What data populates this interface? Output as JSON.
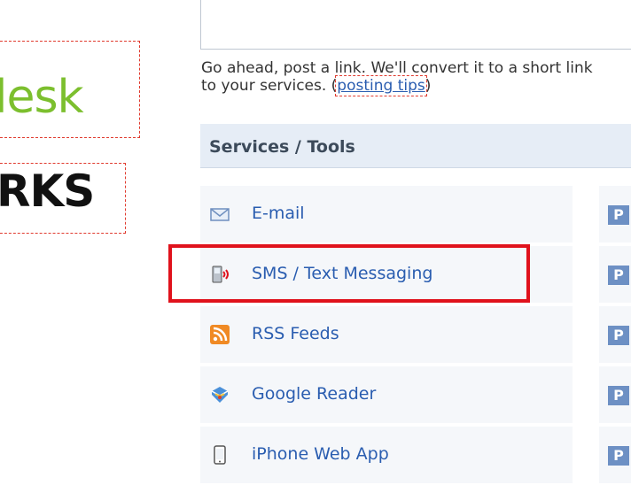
{
  "logos": {
    "first": "lesk",
    "second": "RKS"
  },
  "post": {
    "help_line1": "Go ahead, post a link. We'll convert it to a short link",
    "help_line2_prefix": "to your services. (",
    "tips_link": "posting tips",
    "help_line2_suffix": ")"
  },
  "services": {
    "title": "Services / Tools",
    "items": [
      {
        "label": "E-mail",
        "icon": "email-icon",
        "badge": "P"
      },
      {
        "label": "SMS / Text Messaging",
        "icon": "sms-phone-icon",
        "badge": "P"
      },
      {
        "label": "RSS Feeds",
        "icon": "rss-icon",
        "badge": "P"
      },
      {
        "label": "Google Reader",
        "icon": "google-reader-icon",
        "badge": "P"
      },
      {
        "label": "iPhone Web App",
        "icon": "iphone-icon",
        "badge": "P"
      }
    ]
  },
  "colors": {
    "link": "#2a5db0",
    "highlight": "#e0121c",
    "logo_green": "#7cbf2e",
    "badge": "#6d90c4"
  }
}
